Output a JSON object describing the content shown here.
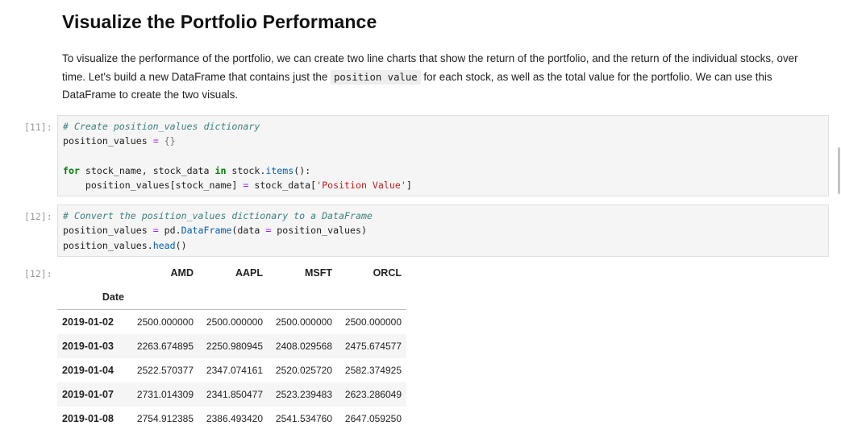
{
  "markdown": {
    "title": "Visualize the Portfolio Performance",
    "para_before": "To visualize the performance of the portfolio, we can create two line charts that show the return of the portfolio, and the return of the individual stocks, over time. Let's build a new DataFrame that contains just the ",
    "para_code": "position value",
    "para_after": " for each stock, as well as the total value for the portfolio. We can use this DataFrame to create the two visuals."
  },
  "cells": [
    {
      "prompt": "[11]:"
    },
    {
      "prompt": "[12]:"
    },
    {
      "prompt": "[12]:"
    }
  ],
  "code1": {
    "comment": "# Create position_values dictionary",
    "l2_var": "position_values ",
    "l2_op": "=",
    "l2_val": " {}",
    "l4_kw1": "for",
    "l4_mid": " stock_name, stock_data ",
    "l4_kw2": "in",
    "l4_obj": " stock.",
    "l4_fn": "items",
    "l4_end": "():",
    "l5_a": "    position_values[stock_name] ",
    "l5_op": "=",
    "l5_b": " stock_data[",
    "l5_str": "'Position Value'",
    "l5_end": "]"
  },
  "code2": {
    "comment": "# Convert the position_values dictionary to a DataFrame",
    "l2_var": "position_values ",
    "l2_op": "=",
    "l2_obj": " pd.",
    "l2_fn": "DataFrame",
    "l2_args": "(data ",
    "l2_op2": "=",
    "l2_end": " position_values)",
    "l3_obj": "position_values.",
    "l3_fn": "head",
    "l3_end": "()"
  },
  "dataframe": {
    "columns": [
      "AMD",
      "AAPL",
      "MSFT",
      "ORCL"
    ],
    "index_name": "Date",
    "rows": [
      {
        "date": "2019-01-02",
        "values": [
          "2500.000000",
          "2500.000000",
          "2500.000000",
          "2500.000000"
        ]
      },
      {
        "date": "2019-01-03",
        "values": [
          "2263.674895",
          "2250.980945",
          "2408.029568",
          "2475.674577"
        ]
      },
      {
        "date": "2019-01-04",
        "values": [
          "2522.570377",
          "2347.074161",
          "2520.025720",
          "2582.374925"
        ]
      },
      {
        "date": "2019-01-07",
        "values": [
          "2731.014309",
          "2341.850477",
          "2523.239483",
          "2623.286049"
        ]
      },
      {
        "date": "2019-01-08",
        "values": [
          "2754.912385",
          "2386.493420",
          "2541.534760",
          "2647.059250"
        ]
      }
    ]
  }
}
